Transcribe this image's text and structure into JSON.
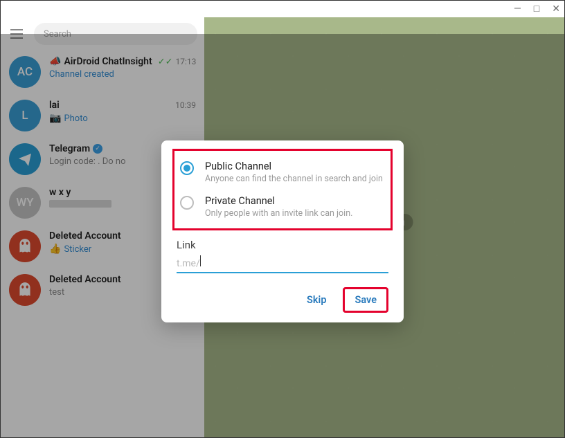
{
  "window_controls": {
    "minimize": "—",
    "maximize": "□",
    "close": "✕"
  },
  "search_placeholder": "Search",
  "chats": [
    {
      "avatar_text": "AC",
      "avatar_bg": "#3a9fd6",
      "name": "AirDroid ChatInsight",
      "time": "17:13",
      "preview": "Channel created",
      "preview_link": true,
      "has_megaphone": true,
      "checks": true,
      "single_check": false
    },
    {
      "avatar_text": "L",
      "avatar_bg": "#3a9fd6",
      "name": "lai",
      "time": "10:39",
      "preview": "Photo",
      "preview_icon": "📷",
      "preview_link": true,
      "checks": false,
      "single_check": false
    },
    {
      "avatar_text": "",
      "avatar_bg": "#2a9fd6",
      "name": "Telegram",
      "verified": true,
      "time": "",
      "preview": "Login code:            . Do no",
      "preview_link": false,
      "is_telegram": true,
      "checks": false,
      "single_check": false
    },
    {
      "avatar_text": "WY",
      "avatar_bg": "#c5c5c5",
      "name": "w x y",
      "time": "",
      "preview": "",
      "preview_blur": true,
      "checks": false,
      "single_check": true
    },
    {
      "avatar_text": "",
      "avatar_bg": "#df4a2e",
      "name": "Deleted Account",
      "time": "",
      "preview": "Sticker",
      "preview_icon": "👍",
      "preview_link": true,
      "is_ghost": true,
      "checks": false,
      "single_check": true
    },
    {
      "avatar_text": "",
      "avatar_bg": "#df4a2e",
      "name": "Deleted Account",
      "time": "",
      "preview": "test",
      "preview_link": false,
      "is_ghost": true,
      "checks": false,
      "single_check": true
    }
  ],
  "main_badge": "messaging",
  "modal": {
    "options": [
      {
        "title": "Public Channel",
        "desc": "Anyone can find the channel in search and join",
        "selected": true
      },
      {
        "title": "Private Channel",
        "desc": "Only people with an invite link can join.",
        "selected": false
      }
    ],
    "link_label": "Link",
    "link_prefix": "t.me/",
    "link_value": "",
    "skip_label": "Skip",
    "save_label": "Save"
  }
}
